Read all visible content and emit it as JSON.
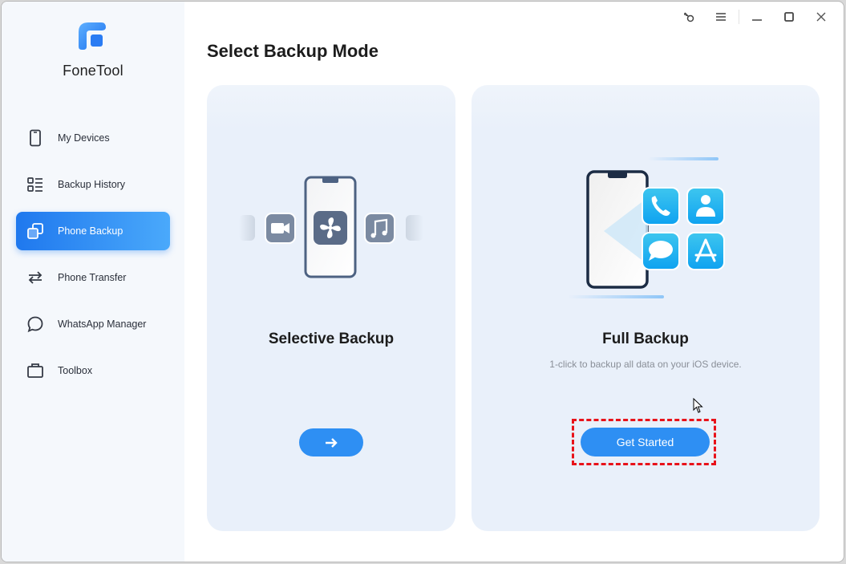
{
  "app": {
    "name": "FoneTool",
    "brand_color": "#2e8ff3"
  },
  "titlebar": {
    "icons": [
      "key-icon",
      "menu-icon",
      "minimize-icon",
      "maximize-icon",
      "close-icon"
    ]
  },
  "sidebar": {
    "items": [
      {
        "label": "My Devices",
        "icon": "phone-icon",
        "active": false
      },
      {
        "label": "Backup History",
        "icon": "list-icon",
        "active": false
      },
      {
        "label": "Phone Backup",
        "icon": "copy-icon",
        "active": true
      },
      {
        "label": "Phone Transfer",
        "icon": "transfer-arrows-icon",
        "active": false
      },
      {
        "label": "WhatsApp Manager",
        "icon": "chat-bubble-icon",
        "active": false
      },
      {
        "label": "Toolbox",
        "icon": "toolbox-icon",
        "active": false
      }
    ]
  },
  "main": {
    "title": "Select Backup Mode",
    "cards": [
      {
        "title": "Selective Backup",
        "description": "",
        "button": "→",
        "illustration_icons": [
          "video-icon",
          "fan-icon",
          "music-note-icon"
        ]
      },
      {
        "title": "Full Backup",
        "description": "1-click to backup all data on your iOS device.",
        "button": "Get Started",
        "highlight_color": "#e8121a",
        "illustration_icons": [
          "phone-call-icon",
          "contact-icon",
          "message-icon",
          "app-store-icon"
        ]
      }
    ]
  }
}
